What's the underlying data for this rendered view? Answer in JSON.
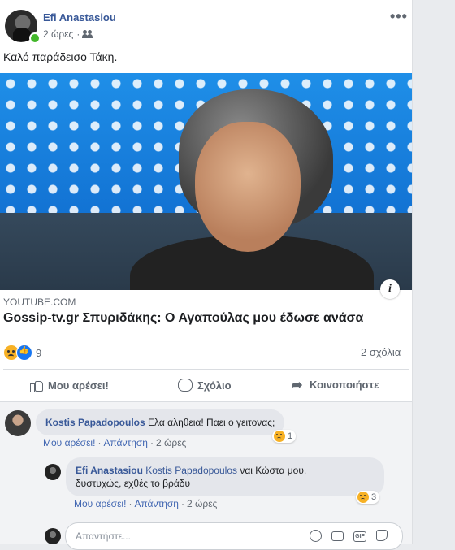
{
  "post": {
    "author": "Efi Anastasiou",
    "time": "2 ώρες",
    "dot": "·",
    "text": "Καλό παράδεισο Τάκη.",
    "more": "•••"
  },
  "link": {
    "domain": "YOUTUBE.COM",
    "title": "Gossip-tv.gr Σπυριδάκης: Ο Αγαπούλας μου έδωσε ανάσα",
    "info": "i"
  },
  "stats": {
    "reaction_count": "9",
    "comments": "2 σχόλια"
  },
  "actions": {
    "like": "Μου αρέσει!",
    "comment": "Σχόλιο",
    "share": "Κοινοποιήστε"
  },
  "comments": [
    {
      "author": "Kostis Papadopoulos",
      "text": "Ελα αληθεια! Παει ο γειτονας;",
      "like": "Μου αρέσει!",
      "reply": "Απάντηση",
      "time": "2 ώρες",
      "reactions": "1"
    }
  ],
  "reply": {
    "author": "Efi Anastasiou",
    "tag": "Kostis Papadopoulos",
    "text_line1": "ναι Κώστα μου,",
    "text_line2": "δυστυχώς, εχθές το βράδυ",
    "like": "Μου αρέσει!",
    "reply": "Απάντηση",
    "time": "2 ώρες",
    "reactions": "3"
  },
  "reply_box": {
    "placeholder": "Απαντήστε...",
    "gif": "GIF"
  },
  "colors": {
    "link_blue": "#385898",
    "action_blue": "#4267b2",
    "online_green": "#42b72a"
  }
}
